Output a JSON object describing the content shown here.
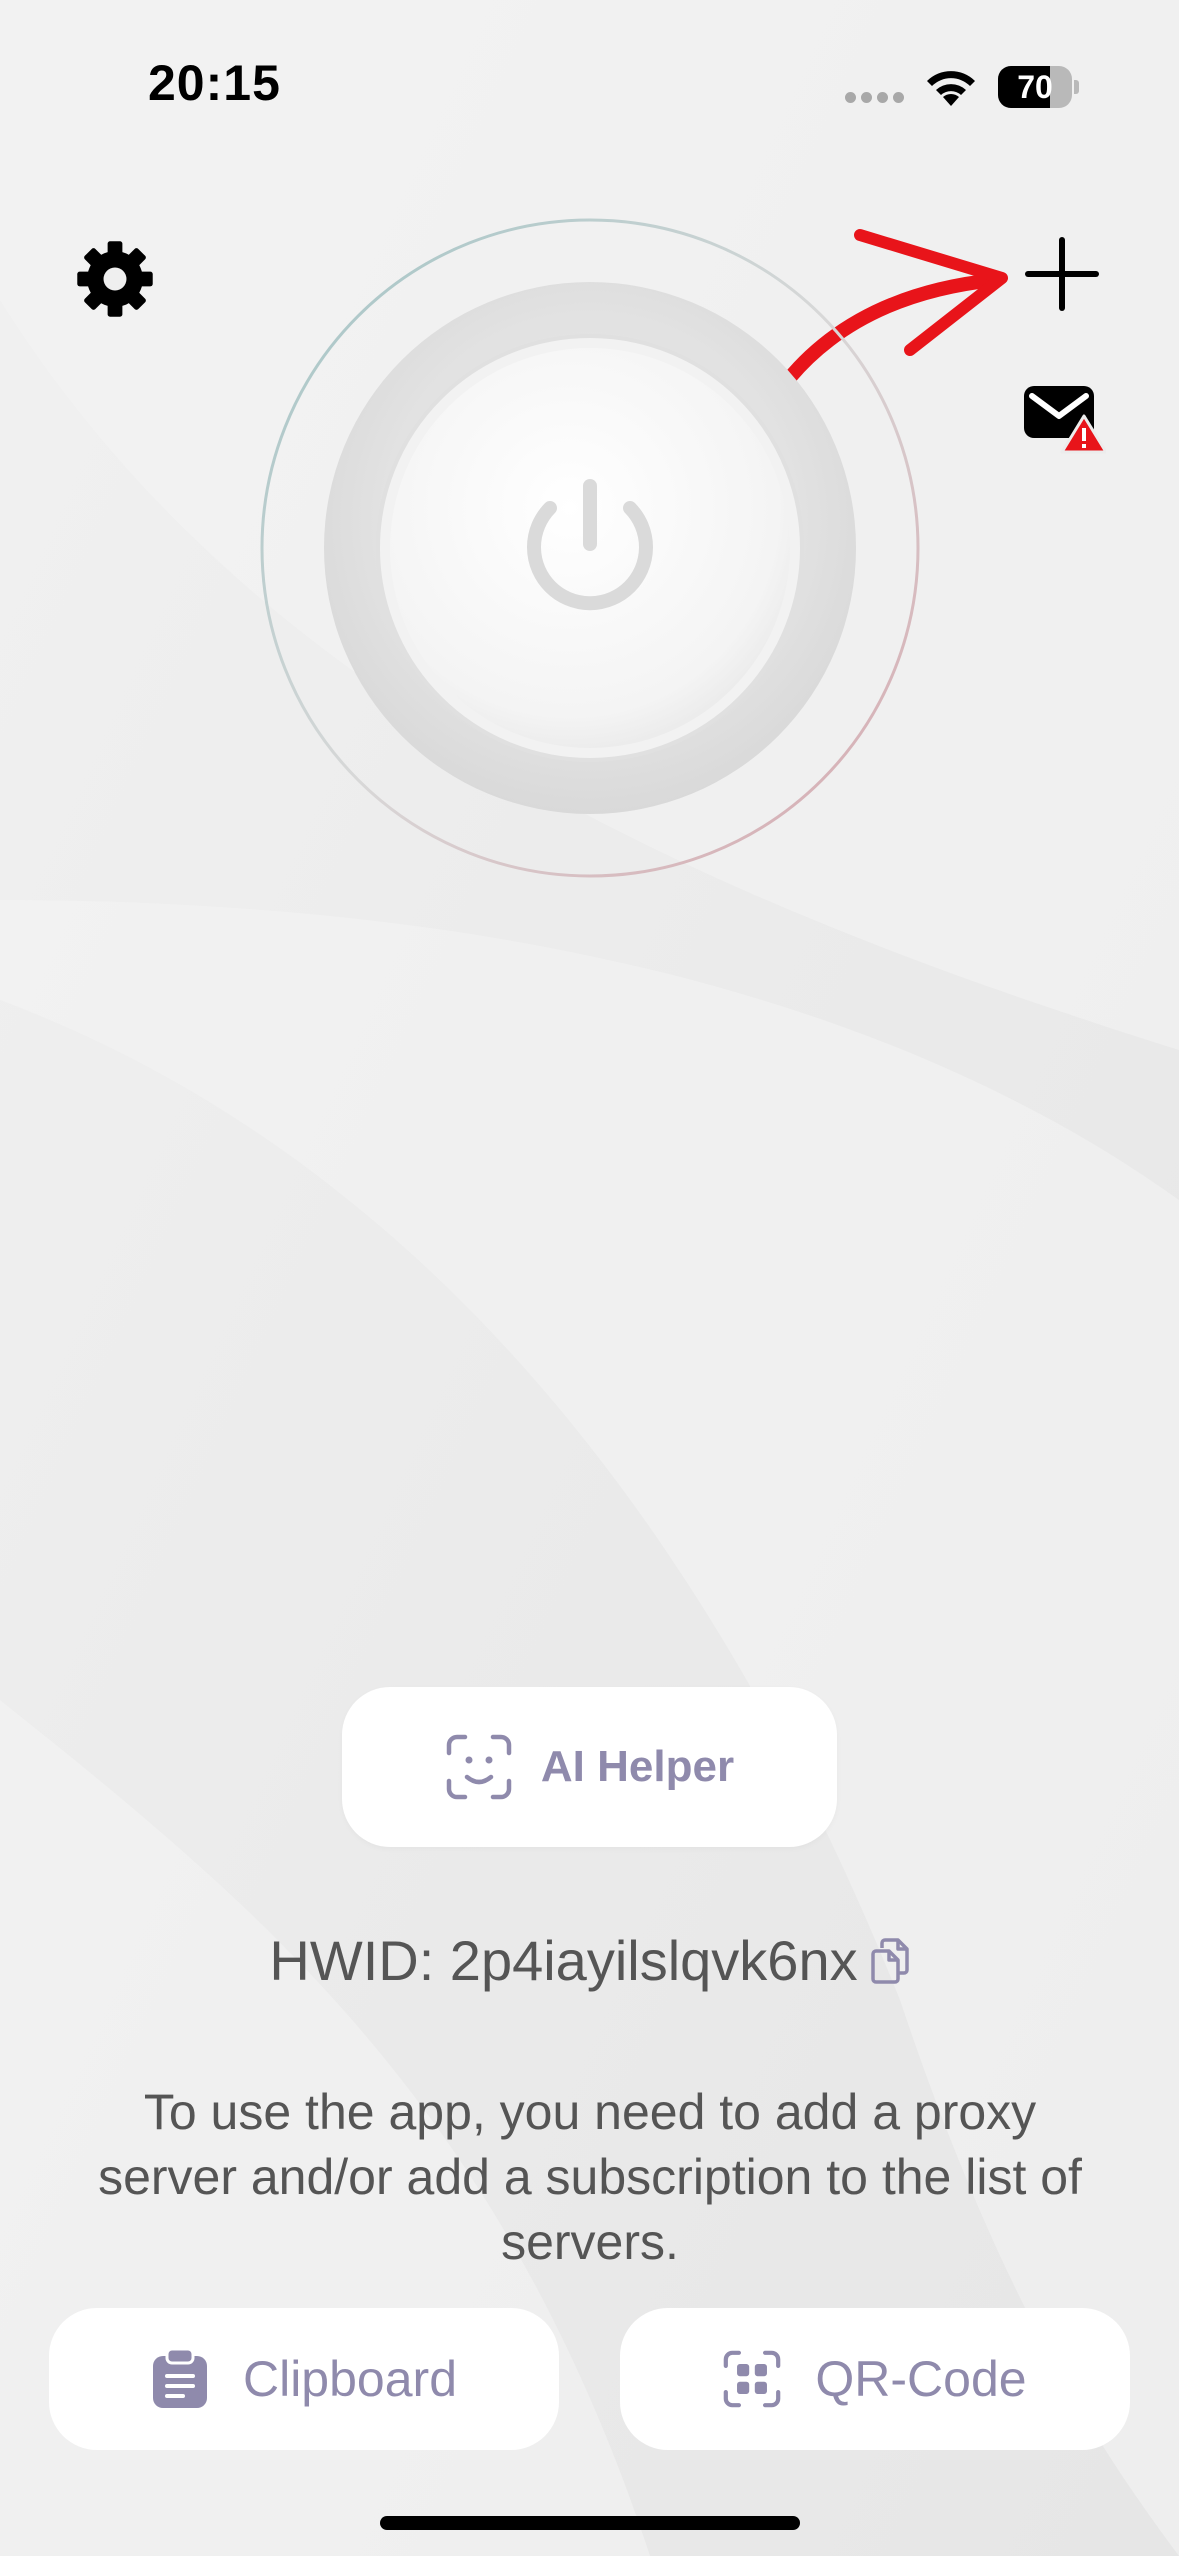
{
  "status_bar": {
    "time": "20:15",
    "battery_percent": "70",
    "battery_level": 0.7
  },
  "toolbar": {
    "settings_icon": "gear-icon",
    "add_icon": "plus-icon",
    "mail_icon": "mail-warning-icon"
  },
  "annotation": {
    "arrow_color": "#e8141a"
  },
  "power_button": {
    "icon": "power-icon"
  },
  "ai_helper": {
    "label": "AI Helper",
    "icon": "face-scan-icon"
  },
  "hwid": {
    "text": "HWID: 2p4iayilslqvk6nx",
    "icon": "copy-icon"
  },
  "info_text": "To use the app, you need to add a proxy server and/or add a subscription to the list of servers.",
  "buttons": {
    "clipboard_label": "Clipboard",
    "qr_label": "QR-Code"
  },
  "colors": {
    "accent_text": "#8f8aac",
    "background": "#ececec"
  }
}
